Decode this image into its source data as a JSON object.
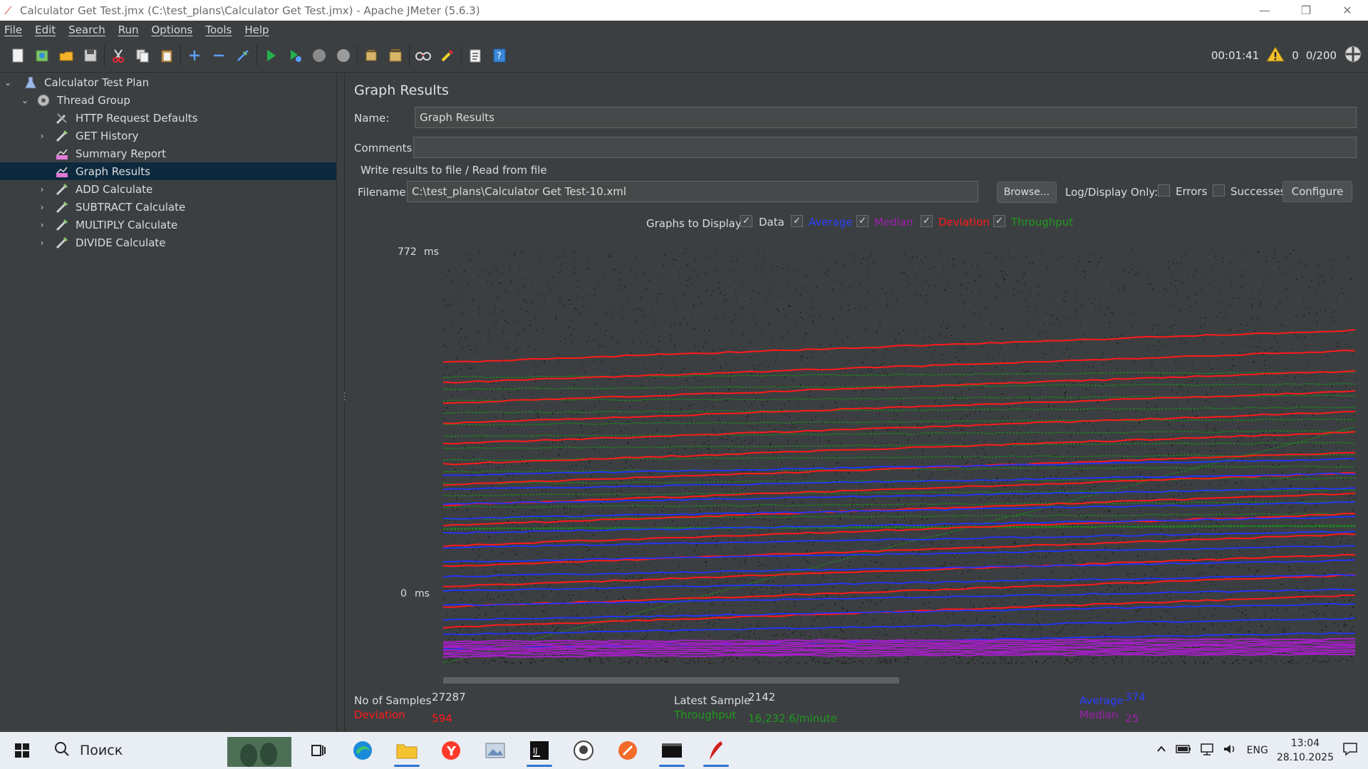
{
  "window": {
    "title": "Calculator Get Test.jmx (C:\\test_plans\\Calculator Get Test.jmx) - Apache JMeter (5.6.3)",
    "minimize": "—",
    "maximize": "❐",
    "close": "✕"
  },
  "menu": [
    "File",
    "Edit",
    "Search",
    "Run",
    "Options",
    "Tools",
    "Help"
  ],
  "toolbar": {
    "elapsed": "00:01:41",
    "warnings": "0",
    "threads": "0/200"
  },
  "tree": [
    {
      "label": "Calculator Test Plan",
      "depth": 0,
      "chevron": "open",
      "icon": "flask-icon"
    },
    {
      "label": "Thread Group",
      "depth": 1,
      "chevron": "open",
      "icon": "gear-icon"
    },
    {
      "label": "HTTP Request Defaults",
      "depth": 2,
      "chevron": "none",
      "icon": "wrench-icon"
    },
    {
      "label": "GET History",
      "depth": 2,
      "chevron": "closed",
      "icon": "pipette-icon"
    },
    {
      "label": "Summary Report",
      "depth": 2,
      "chevron": "none",
      "icon": "chart-icon"
    },
    {
      "label": "Graph Results",
      "depth": 2,
      "chevron": "none",
      "icon": "chart-icon",
      "selected": true
    },
    {
      "label": "ADD Calculate",
      "depth": 2,
      "chevron": "closed",
      "icon": "pipette-icon"
    },
    {
      "label": "SUBTRACT Calculate",
      "depth": 2,
      "chevron": "closed",
      "icon": "pipette-icon"
    },
    {
      "label": "MULTIPLY Calculate",
      "depth": 2,
      "chevron": "closed",
      "icon": "pipette-icon"
    },
    {
      "label": "DIVIDE Calculate",
      "depth": 2,
      "chevron": "closed",
      "icon": "pipette-icon"
    }
  ],
  "panel": {
    "title": "Graph Results",
    "name_label": "Name:",
    "name_value": "Graph Results",
    "comments_label": "Comments:",
    "comments_value": "",
    "file_section": "Write results to file / Read from file",
    "filename_label": "Filename",
    "filename_value": "C:\\test_plans\\Calculator Get Test-10.xml",
    "browse": "Browse...",
    "log_display": "Log/Display Only:",
    "errors": "Errors",
    "successes": "Successes",
    "configure": "Configure",
    "graphs_to_display": "Graphs to Display",
    "toggles": [
      {
        "label": "Data",
        "color": "#dcdcdc",
        "checked": true
      },
      {
        "label": "Average",
        "color": "#2b3fff",
        "checked": true
      },
      {
        "label": "Median",
        "color": "#9c1fb0",
        "checked": true
      },
      {
        "label": "Deviation",
        "color": "#ff1a1a",
        "checked": true
      },
      {
        "label": "Throughput",
        "color": "#1f9a1f",
        "checked": true
      }
    ]
  },
  "chart_data": {
    "type": "line",
    "ylabel_max": "772",
    "ylabel_min": "0",
    "y_unit": "ms",
    "ylim": [
      0,
      772
    ],
    "samples_x_range": [
      0,
      27287
    ],
    "series": [
      {
        "name": "Average",
        "color": "#2233ff",
        "approx_final": 374
      },
      {
        "name": "Median",
        "color": "#a020c0"
      },
      {
        "name": "Deviation",
        "color": "#ff1a1a",
        "approx_final": 594
      },
      {
        "name": "Throughput",
        "color": "#1c8a1c"
      }
    ]
  },
  "stats": {
    "samples_label": "No of Samples",
    "samples_value": "27287",
    "latest_label": "Latest Sample",
    "latest_value": "2142",
    "average_label": "Average",
    "average_value": "374",
    "deviation_label": "Deviation",
    "deviation_value": "594",
    "throughput_label": "Throughput",
    "throughput_value": "16,232.6/minute",
    "median_label": "Median",
    "median_value": "25"
  },
  "taskbar": {
    "search": "Поиск",
    "lang": "ENG",
    "time": "13:04",
    "date": "28.10.2025"
  }
}
